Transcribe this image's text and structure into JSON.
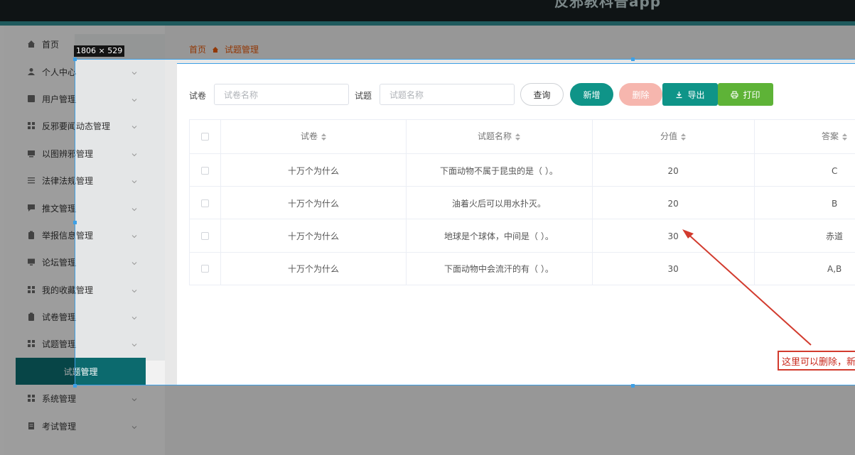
{
  "app": {
    "title": "反邪教科普app"
  },
  "overlay": {
    "size_label": "1806 × 529"
  },
  "sidebar": {
    "items": [
      {
        "label": "首页",
        "icon": "home-icon",
        "has_chevron": false
      },
      {
        "label": "个人中心",
        "icon": "user-icon",
        "has_chevron": true
      },
      {
        "label": "用户管理",
        "icon": "users-icon",
        "has_chevron": true
      },
      {
        "label": "反邪要闻动态管理",
        "icon": "grid-icon",
        "has_chevron": true
      },
      {
        "label": "以图辨邪管理",
        "icon": "image-icon",
        "has_chevron": true
      },
      {
        "label": "法律法规管理",
        "icon": "sliders-icon",
        "has_chevron": true
      },
      {
        "label": "推文管理",
        "icon": "message-icon",
        "has_chevron": true
      },
      {
        "label": "举报信息管理",
        "icon": "clipboard-icon",
        "has_chevron": true
      },
      {
        "label": "论坛管理",
        "icon": "monitor-icon",
        "has_chevron": true
      },
      {
        "label": "我的收藏管理",
        "icon": "grid-icon",
        "has_chevron": true
      },
      {
        "label": "试卷管理",
        "icon": "clipboard-icon",
        "has_chevron": true
      },
      {
        "label": "试题管理",
        "icon": "grid-icon",
        "has_chevron": true
      },
      {
        "label": "系统管理",
        "icon": "grid-icon",
        "has_chevron": true
      },
      {
        "label": "考试管理",
        "icon": "document-icon",
        "has_chevron": true
      }
    ],
    "active_sub_item": "试题管理"
  },
  "breadcrumb": {
    "home": "首页",
    "current": "试题管理"
  },
  "search": {
    "paper_label": "试卷",
    "paper_placeholder": "试卷名称",
    "question_label": "试题",
    "question_placeholder": "试题名称"
  },
  "toolbar": {
    "query_label": "查询",
    "add_label": "新增",
    "delete_label": "删除",
    "export_label": "导出",
    "print_label": "打印"
  },
  "table": {
    "columns": [
      "试卷",
      "试题名称",
      "分值",
      "答案"
    ],
    "rows": [
      {
        "paper": "十万个为什么",
        "question": "下面动物不属于昆虫的是（ ）。",
        "score": "20",
        "answer": "C"
      },
      {
        "paper": "十万个为什么",
        "question": "油着火后可以用水扑灭。",
        "score": "20",
        "answer": "B"
      },
      {
        "paper": "十万个为什么",
        "question": "地球是个球体，中间是（ ）。",
        "score": "30",
        "answer": "赤道"
      },
      {
        "paper": "十万个为什么",
        "question": "下面动物中会流汗的有（ ）。",
        "score": "30",
        "answer": "A,B"
      }
    ]
  },
  "annotation": {
    "text": "这里可以删除，新"
  },
  "colors": {
    "primary": "#0f9488",
    "active_bg": "#0c6a6e",
    "delete_bg": "#f6b6ae",
    "print_bg": "#5eb337",
    "breadcrumb": "#e0560a",
    "annotation": "#d23b2e",
    "selection": "#3da0e6"
  }
}
